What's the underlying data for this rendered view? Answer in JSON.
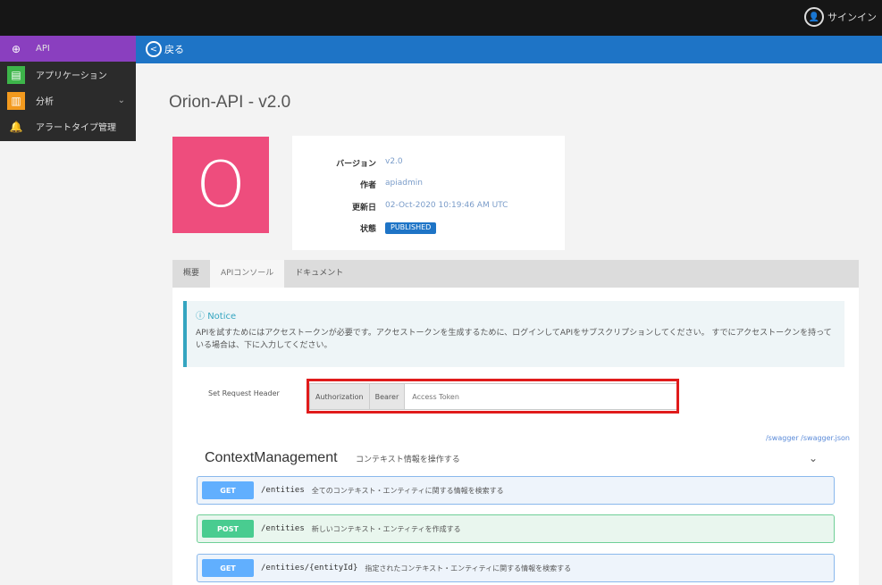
{
  "topbar": {
    "signin_label": "サインイン"
  },
  "subbar": {
    "back_label": "戻る"
  },
  "sidebar": {
    "items": [
      {
        "label": "API",
        "icon": "globe-icon"
      },
      {
        "label": "アプリケーション",
        "icon": "application-icon"
      },
      {
        "label": "分析",
        "icon": "analytics-icon"
      },
      {
        "label": "アラートタイプ管理",
        "icon": "bell-icon"
      }
    ]
  },
  "page": {
    "title": "Orion-API - v2.0"
  },
  "logo": {
    "letter": "O",
    "color": "#ee4d7d"
  },
  "info": {
    "version_label": "バージョン",
    "version_value": "v2.0",
    "author_label": "作者",
    "author_value": "apiadmin",
    "updated_label": "更新日",
    "updated_value": "02-Oct-2020 10:19:46 AM UTC",
    "status_label": "状態",
    "status_value": "PUBLISHED"
  },
  "tabs": [
    {
      "label": "概要"
    },
    {
      "label": "APIコンソール"
    },
    {
      "label": "ドキュメント"
    }
  ],
  "notice": {
    "title": "Notice",
    "text": "APIを試すためにはアクセストークンが必要です。アクセストークンを生成するために、ログインしてAPIをサブスクリプションしてください。 すでにアクセストークンを持っている場合は、下に入力してください。"
  },
  "request": {
    "label": "Set Request Header",
    "addon_auth": "Authorization",
    "addon_bearer": "Bearer",
    "placeholder": "Access Token"
  },
  "swagger": {
    "link": "/swagger /swagger.json"
  },
  "section": {
    "title": "ContextManagement",
    "description": "コンテキスト情報を操作する"
  },
  "endpoints": [
    {
      "method": "GET",
      "path": "/entities",
      "description": "全てのコンテキスト・エンティティに関する情報を検索する"
    },
    {
      "method": "POST",
      "path": "/entities",
      "description": "新しいコンテキスト・エンティティを作成する"
    },
    {
      "method": "GET",
      "path": "/entities/{entityId}",
      "description": "指定されたコンテキスト・エンティティに関する情報を検索する"
    }
  ]
}
